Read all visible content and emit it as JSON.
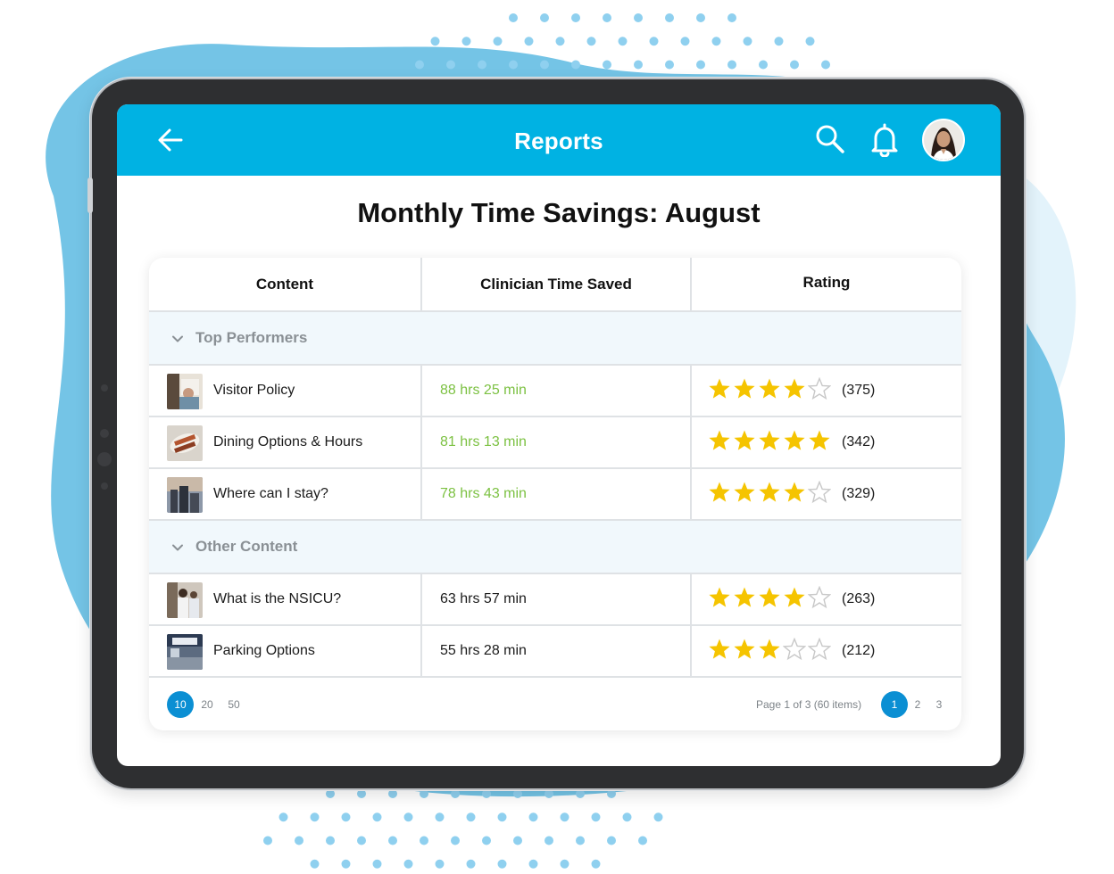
{
  "appbar": {
    "title": "Reports",
    "bg_color": "#00b2e3",
    "back_icon": "arrow-left-icon",
    "search_icon": "search-icon",
    "notification_icon": "bell-icon",
    "avatar": "user-avatar"
  },
  "page": {
    "title": "Monthly Time Savings: August"
  },
  "table": {
    "columns": [
      "Content",
      "Clinician Time Saved",
      "Rating"
    ],
    "groups": [
      {
        "label": "Top Performers",
        "expanded": true,
        "rows": [
          {
            "name": "Visitor Policy",
            "time": "88 hrs 25 min",
            "rating": 4,
            "count": "(375)",
            "highlight": true
          },
          {
            "name": "Dining Options & Hours",
            "time": "81 hrs 13 min",
            "rating": 5,
            "count": "(342)",
            "highlight": true
          },
          {
            "name": "Where can I stay?",
            "time": "78 hrs 43 min",
            "rating": 4,
            "count": "(329)",
            "highlight": true
          }
        ]
      },
      {
        "label": "Other Content",
        "expanded": true,
        "rows": [
          {
            "name": "What is the NSICU?",
            "time": "63 hrs 57 min",
            "rating": 4,
            "count": "(263)",
            "highlight": false
          },
          {
            "name": "Parking Options",
            "time": "55 hrs 28 min",
            "rating": 3,
            "count": "(212)",
            "highlight": false
          }
        ]
      }
    ],
    "max_rating": 5
  },
  "pagination": {
    "page_sizes": [
      "10",
      "20",
      "50"
    ],
    "selected_page_size": "10",
    "info": "Page 1 of 3 (60 items)",
    "pages": [
      "1",
      "2",
      "3"
    ],
    "current_page": "1"
  },
  "colors": {
    "accent": "#00b2e3",
    "highlight_time": "#7cc142",
    "star_filled": "#f5c400",
    "star_empty": "#c8c8c8",
    "pager_active": "#0b8fd3",
    "background_blob": "#74c4e6"
  }
}
